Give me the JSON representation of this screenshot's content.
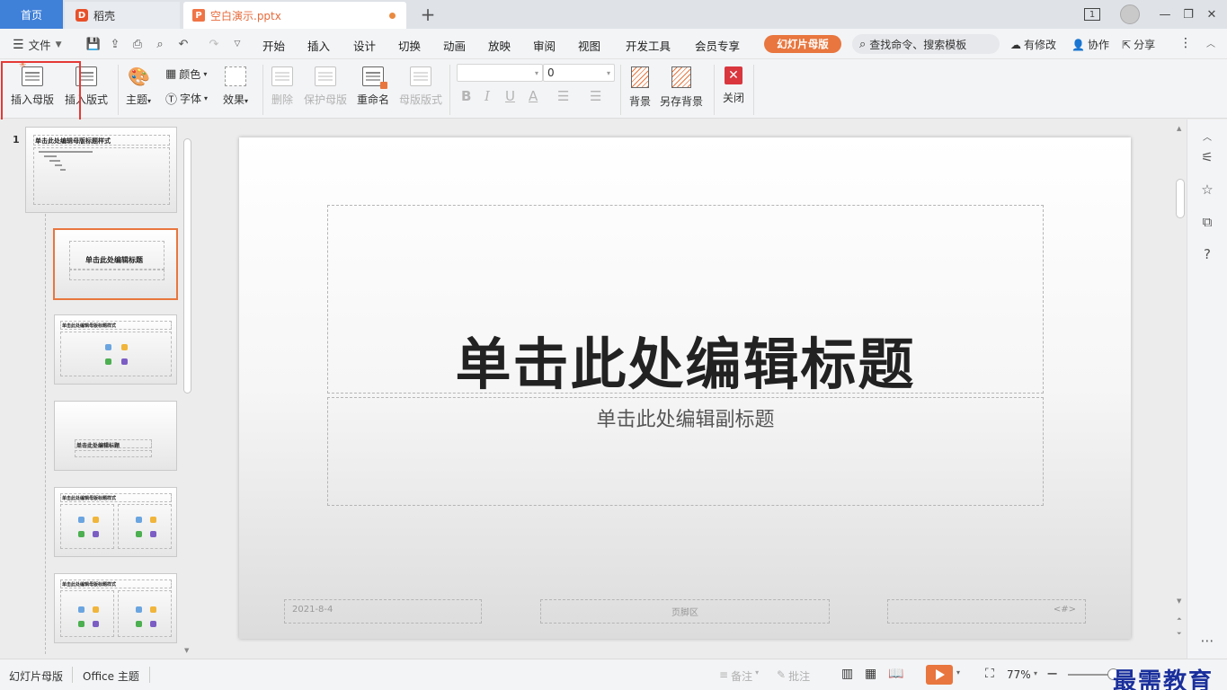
{
  "tabs": {
    "home": "首页",
    "daoke": "稻壳",
    "doc": "空白演示.pptx"
  },
  "window": {
    "badge": "1"
  },
  "menu": {
    "file": "文件",
    "items": [
      "开始",
      "插入",
      "设计",
      "切换",
      "动画",
      "放映",
      "审阅",
      "视图",
      "开发工具",
      "会员专享"
    ],
    "active": "幻灯片母版",
    "search": "查找命令、搜索模板",
    "modify": "有修改",
    "collab": "协作",
    "share": "分享"
  },
  "ribbon": {
    "insert_master": "插入母版",
    "insert_layout": "插入版式",
    "theme": "主题",
    "color": "颜色",
    "font": "字体",
    "effect": "效果",
    "delete": "删除",
    "protect_master": "保护母版",
    "rename": "重命名",
    "master_layout": "母版版式",
    "font_name": "",
    "font_size": "0",
    "bold": "B",
    "italic": "I",
    "underline": "U",
    "font_color": "A",
    "background": "背景",
    "save_background": "另存背景",
    "close": "关闭"
  },
  "thumbnails": {
    "slide_number": "1",
    "master_title": "单击此处编辑母版标题样式",
    "layout_title": "单击此处编辑标题",
    "section_title": "单击此处编辑标题"
  },
  "slide": {
    "title": "单击此处编辑标题",
    "subtitle": "单击此处编辑副标题",
    "date": "2021-8-4",
    "footer": "页脚区",
    "page_num": "<#>"
  },
  "status": {
    "view_name": "幻灯片母版",
    "theme_name": "Office 主题",
    "notes": "备注",
    "comments": "批注",
    "zoom": "77%"
  },
  "watermark": "最需教育",
  "colors": {
    "accent": "#e8763e",
    "home_tab": "#3f80d9",
    "annotation": "#e53935"
  }
}
